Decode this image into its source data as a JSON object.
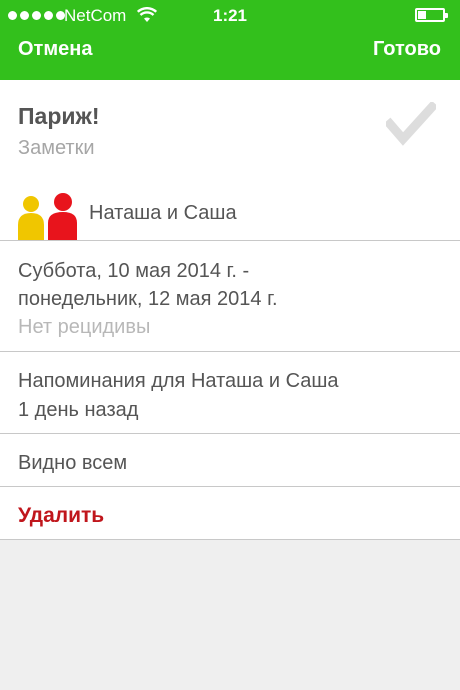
{
  "status_bar": {
    "carrier": "NetCom",
    "time": "1:21",
    "signal_bars": 5,
    "battery_level": 0.25
  },
  "navbar": {
    "cancel_label": "Отмена",
    "done_label": "Готово",
    "background_color": "#33c01c"
  },
  "event": {
    "title": "Париж!",
    "notes_placeholder": "Заметки",
    "participants": "Наташа и Саша",
    "date_line_1": "Суббота, 10 мая 2014 г. -",
    "date_line_2": "понедельник, 12 мая 2014 г.",
    "recurrence": "Нет рецидивы",
    "reminder_line_1": "Напоминания для Наташа и Саша",
    "reminder_line_2": "1 день назад",
    "visibility": "Видно всем",
    "delete_label": "Удалить",
    "participant_colors": [
      "#f0c600",
      "#e8141c"
    ],
    "delete_color": "#c0161c"
  },
  "icons": {
    "check": "checkmark-icon",
    "people": "people-icon"
  }
}
